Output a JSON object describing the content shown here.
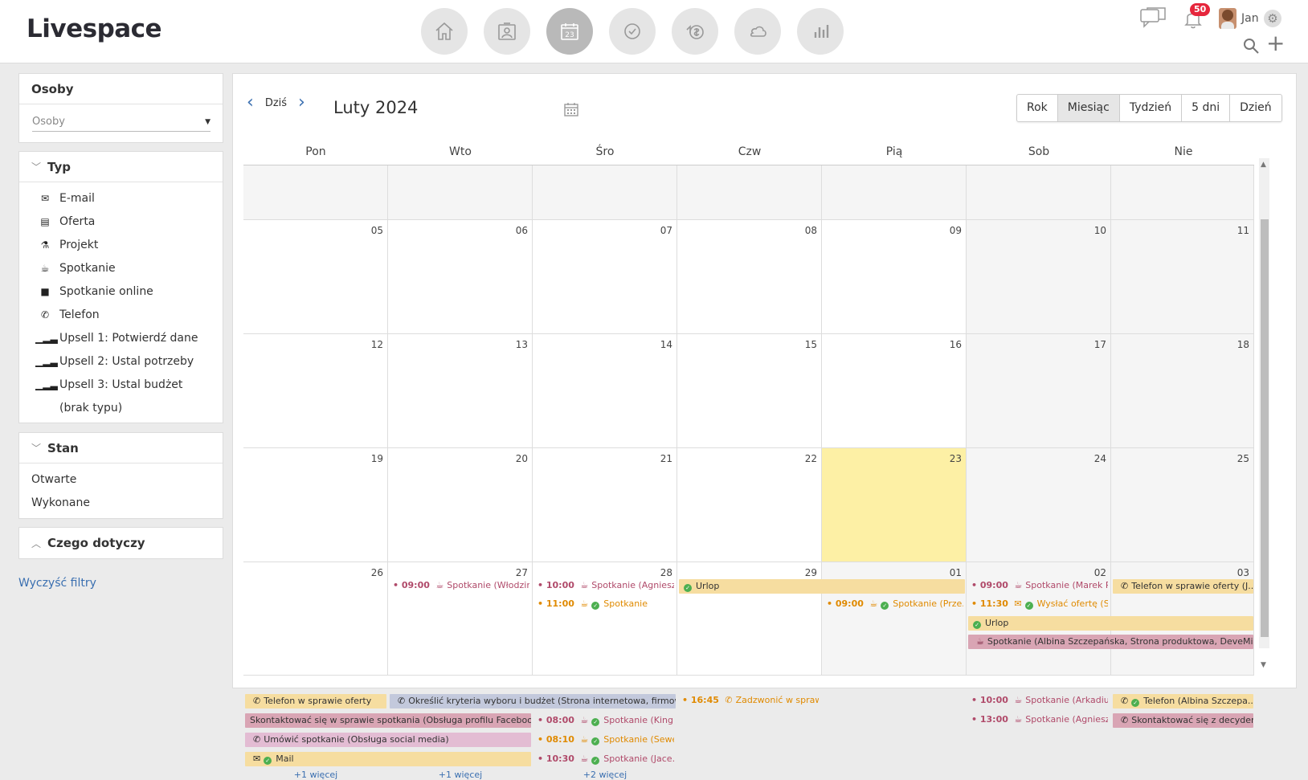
{
  "brand": {
    "logo": "Livespace"
  },
  "nav": [
    {
      "name": "home-icon"
    },
    {
      "name": "contacts-icon"
    },
    {
      "name": "calendar-icon",
      "day": "23"
    },
    {
      "name": "tasks-icon"
    },
    {
      "name": "deals-icon"
    },
    {
      "name": "cloud-icon"
    },
    {
      "name": "reports-icon"
    }
  ],
  "user": {
    "name": "Jan",
    "notifications": "50"
  },
  "filters": {
    "osoby": {
      "title": "Osoby",
      "placeholder": "Osoby"
    },
    "typ": {
      "title": "Typ",
      "items": [
        "E-mail",
        "Oferta",
        "Projekt",
        "Spotkanie",
        "Spotkanie online",
        "Telefon",
        "Upsell 1: Potwierdź dane",
        "Upsell 2: Ustal potrzeby",
        "Upsell 3: Ustal budżet",
        "(brak typu)"
      ]
    },
    "stan": {
      "title": "Stan",
      "items": [
        "Otwarte",
        "Wykonane"
      ]
    },
    "czego": {
      "title": "Czego dotyczy"
    },
    "clear": "Wyczyść filtry"
  },
  "calendar": {
    "today_label": "Dziś",
    "title": "Luty 2024",
    "views": [
      "Rok",
      "Miesiąc",
      "Tydzień",
      "5 dni",
      "Dzień"
    ],
    "active_view": "Miesiąc",
    "weekdays": [
      "Pon",
      "Wto",
      "Śro",
      "Czw",
      "Pią",
      "Sob",
      "Nie"
    ],
    "weeks": [
      [
        "",
        "",
        "",
        "",
        "",
        "",
        ""
      ],
      [
        "05",
        "06",
        "07",
        "08",
        "09",
        "10",
        "11"
      ],
      [
        "12",
        "13",
        "14",
        "15",
        "16",
        "17",
        "18"
      ],
      [
        "19",
        "20",
        "21",
        "22",
        "23",
        "24",
        "25"
      ],
      [
        "26",
        "27",
        "28",
        "29",
        "01",
        "02",
        "03"
      ]
    ],
    "events": {
      "w4": [
        {
          "time": "09:00",
          "text": "Spotkanie (Włodzim...",
          "color": "#b04a6a"
        },
        {
          "time": "10:00",
          "text": "Spotkanie (Agnieszk...",
          "color": "#b04a6a"
        },
        {
          "time": "11:00",
          "text": "Spotkanie",
          "color": "#e08a00"
        },
        {
          "text": "Urlop"
        },
        {
          "time": "09:00",
          "text": "Spotkanie (Prze...",
          "color": "#e08a00"
        },
        {
          "time": "09:00",
          "text": "Spotkanie (Marek P...",
          "color": "#b04a6a"
        },
        {
          "time": "11:30",
          "text": "Wysłać ofertę (S...",
          "color": "#e08a00"
        },
        {
          "text": "Urlop"
        },
        {
          "text": "Spotkanie (Albina Szczepańska, Strona produktowa, DeveMill)"
        },
        {
          "text": "Telefon w sprawie oferty (J..."
        }
      ],
      "w5": [
        {
          "text": "Telefon w sprawie oferty"
        },
        {
          "text": "Określić kryteria wyboru i budżet (Strona internetowa, firmowa)"
        },
        {
          "text": "Skontaktować się w sprawie spotkania (Obsługa profilu Facebook)"
        },
        {
          "text": "Umówić spotkanie (Obsługa social media)"
        },
        {
          "text": "Mail"
        },
        {
          "time": "08:00",
          "text": "Spotkanie (King...",
          "color": "#b04a6a"
        },
        {
          "time": "08:10",
          "text": "Spotkanie (Seweryn...",
          "color": "#e08a00"
        },
        {
          "time": "10:30",
          "text": "Spotkanie (Jace...",
          "color": "#b04a6a"
        },
        {
          "time": "16:45",
          "text": "Zadzwonić w sprawi...",
          "color": "#e08a00"
        },
        {
          "time": "10:00",
          "text": "Spotkanie (Arkadius...",
          "color": "#b04a6a"
        },
        {
          "time": "13:00",
          "text": "Spotkanie (Agnieszk...",
          "color": "#b04a6a"
        },
        {
          "text": "Telefon (Albina Szczepa..."
        },
        {
          "text": "Skontaktować się z decyden..."
        }
      ],
      "more": [
        "+1 więcej",
        "+1 więcej",
        "+2 więcej"
      ]
    }
  }
}
